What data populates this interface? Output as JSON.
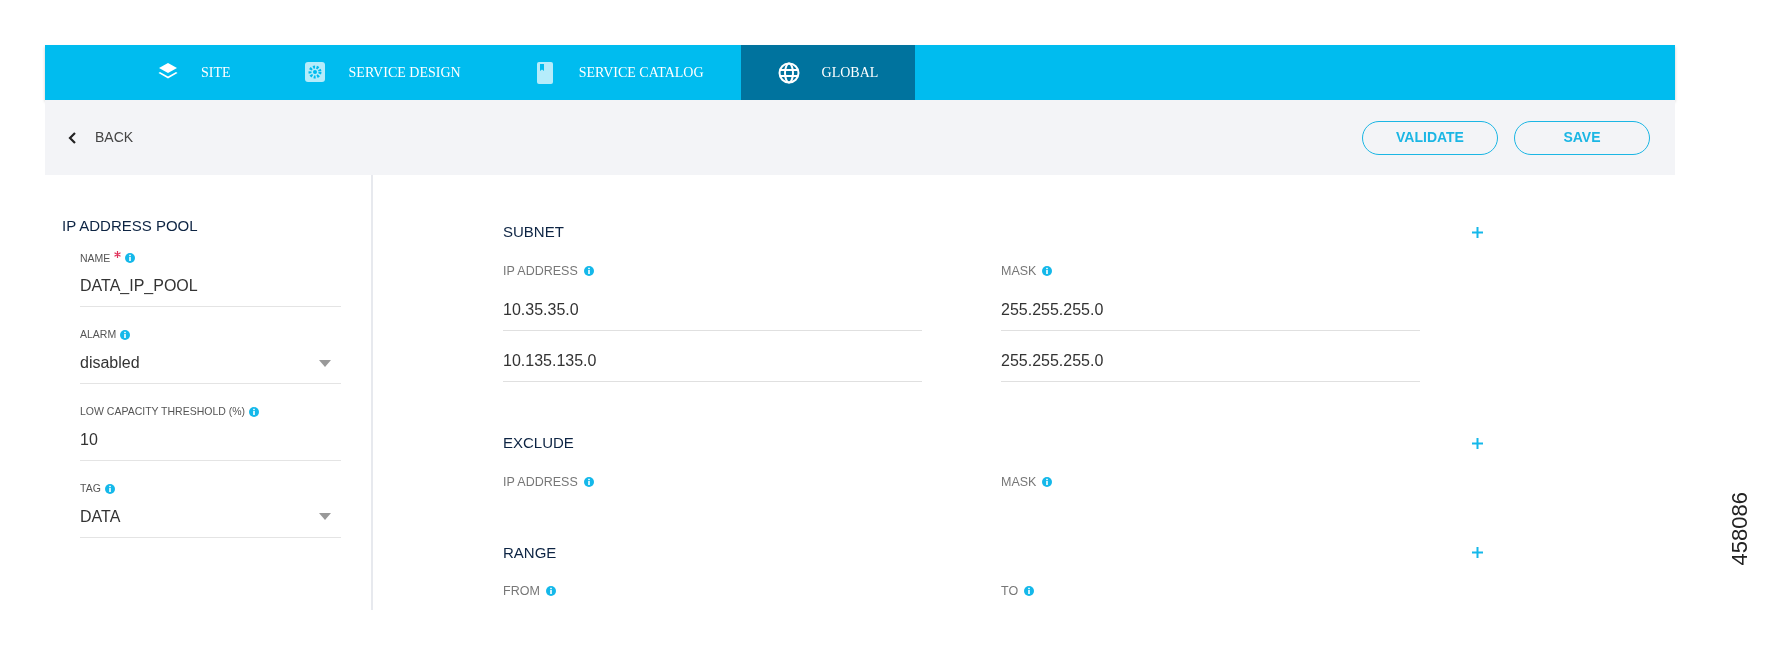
{
  "nav": {
    "tabs": [
      {
        "label": "SITE",
        "selected": false
      },
      {
        "label": "SERVICE DESIGN",
        "selected": false
      },
      {
        "label": "SERVICE CATALOG",
        "selected": false
      },
      {
        "label": "GLOBAL",
        "selected": true
      }
    ]
  },
  "toolbar": {
    "back": "BACK",
    "buttons": [
      "VALIDATE",
      "SAVE"
    ]
  },
  "left_panel": {
    "title": "IP ADDRESS POOL",
    "fields": [
      {
        "kind": "text",
        "label": "NAME",
        "required": true,
        "value": "DATA_IP_POOL"
      },
      {
        "kind": "select",
        "label": "ALARM",
        "required": false,
        "value": "disabled"
      },
      {
        "kind": "text",
        "label": "LOW CAPACITY THRESHOLD (%)",
        "required": false,
        "value": "10"
      },
      {
        "kind": "select",
        "label": "TAG",
        "required": false,
        "value": "DATA"
      }
    ]
  },
  "sections": [
    {
      "title": "SUBNET",
      "columns": [
        "IP ADDRESS",
        "MASK"
      ],
      "rows": [
        [
          "10.35.35.0",
          "255.255.255.0"
        ],
        [
          "10.135.135.0",
          "255.255.255.0"
        ]
      ]
    },
    {
      "title": "EXCLUDE",
      "columns": [
        "IP ADDRESS",
        "MASK"
      ]
    },
    {
      "title": "RANGE",
      "columns": [
        "FROM",
        "TO"
      ]
    }
  ],
  "figure_number": "458086"
}
